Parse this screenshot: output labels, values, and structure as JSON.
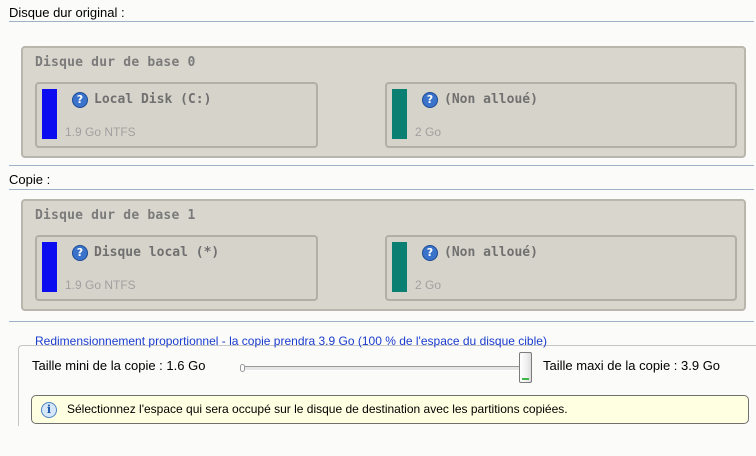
{
  "original": {
    "label": "Disque dur original :",
    "disk_title": "Disque dur de base 0",
    "partitions": [
      {
        "name": "Local Disk (C:)",
        "size": "1.9 Go NTFS",
        "color": "#0c0cf0",
        "help_icon": "help-icon"
      },
      {
        "name": "(Non alloué)",
        "size": "2 Go",
        "color": "#0b7f72",
        "help_icon": "help-icon"
      }
    ]
  },
  "copy": {
    "label": "Copie :",
    "disk_title": "Disque dur de base 1",
    "partitions": [
      {
        "name": "Disque local (*)",
        "size": "1.9 Go NTFS",
        "color": "#0c0cf0",
        "help_icon": "help-icon"
      },
      {
        "name": "(Non alloué)",
        "size": "2 Go",
        "color": "#0b7f72",
        "help_icon": "help-icon"
      }
    ]
  },
  "resize": {
    "caption": "Redimensionnement proportionnel - la copie prendra 3.9 Go (100 % de l'espace du disque cible)",
    "min_label": "Taille mini de la copie :  1.6 Go",
    "max_label": "Taille maxi de la copie :  3.9 Go",
    "slider_value_fraction": 1.0
  },
  "info": {
    "icon": "info-icon",
    "text": "Sélectionnez l'espace qui sera occupé sur le disque de destination avec les partitions copiées."
  }
}
